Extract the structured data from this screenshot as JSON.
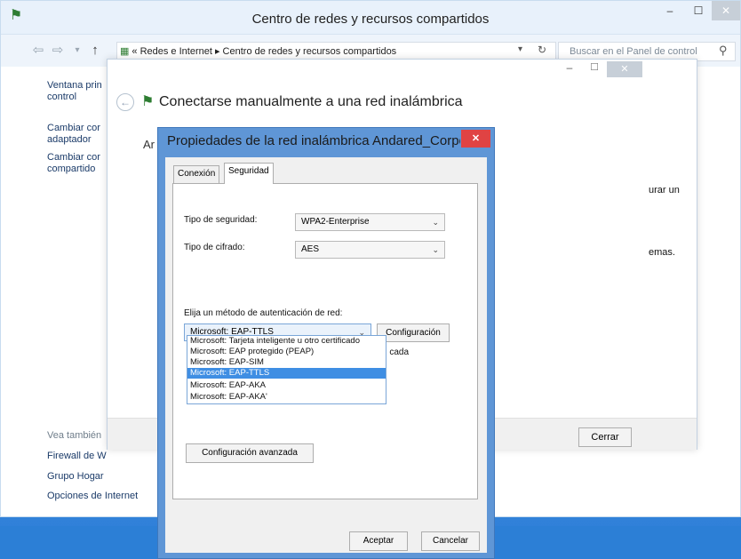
{
  "main_window": {
    "title": "Centro de redes y recursos compartidos",
    "minimize": "–",
    "maximize": "☐",
    "close": "✕"
  },
  "addressbar": {
    "back": "⇦",
    "forward": "⇨",
    "history": "▾",
    "up": "↑",
    "path": "« Redes e Internet ▸ Centro de redes y recursos compartidos",
    "dropdown": "▾",
    "refresh": "↻",
    "search_placeholder": "Buscar en el Panel de control",
    "search_icon": "⚲"
  },
  "sidebar": {
    "item1_line1": "Ventana prin",
    "item1_line2": "control",
    "item2_line1": "Cambiar cor",
    "item2_line2": "adaptador",
    "item3_line1": "Cambiar cor",
    "item3_line2": "compartido",
    "see_also": "Vea también",
    "links": [
      "Firewall de W",
      "Grupo Hogar",
      "Opciones de Internet"
    ]
  },
  "wizard": {
    "title": "Conectarse manualmente a una red inalámbrica",
    "cut_heading": "Ar",
    "right_text_1": "urar un",
    "right_text_2": "emas.",
    "close_button": "Cerrar",
    "minimize": "–",
    "maximize": "☐",
    "close": "✕"
  },
  "dialog": {
    "title": "Propiedades de la red inalámbrica Andared_Corpo...",
    "close": "✕",
    "tabs": [
      "Conexión",
      "Seguridad"
    ],
    "security_type_label": "Tipo de seguridad:",
    "security_type_value": "WPA2-Enterprise",
    "cipher_label": "Tipo de cifrado:",
    "cipher_value": "AES",
    "auth_label": "Elija un método de autenticación de red:",
    "auth_value": "Microsoft: EAP-TTLS",
    "config_button": "Configuración",
    "hidden_text": "n cada",
    "auth_options": [
      "Microsoft: Tarjeta inteligente u otro certificado",
      "Microsoft: EAP protegido (PEAP)",
      "Microsoft: EAP-SIM",
      "Microsoft: EAP-TTLS",
      "Microsoft: EAP-AKA",
      "Microsoft: EAP-AKA'"
    ],
    "selected_option_index": 3,
    "advanced_button": "Configuración avanzada",
    "ok_button": "Aceptar",
    "cancel_button": "Cancelar"
  },
  "colors": {
    "dialog_frame": "#5f96d6",
    "selection": "#3f8ee3",
    "close_red": "#e04343"
  }
}
